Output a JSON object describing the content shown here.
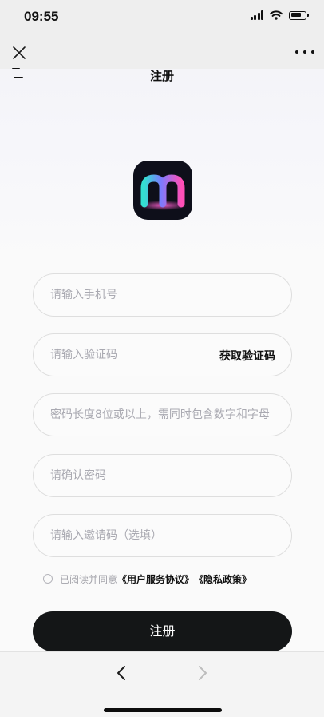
{
  "status_bar": {
    "time": "09:55",
    "icons": [
      "cellular-signal-icon",
      "wifi-icon",
      "battery-icon"
    ]
  },
  "webview_nav": {
    "close_icon": "close-icon",
    "more_icon": "more-dots-icon"
  },
  "page": {
    "title": "注册"
  },
  "form": {
    "phone_placeholder": "请输入手机号",
    "code_placeholder": "请输入验证码",
    "get_code_label": "获取验证码",
    "password_placeholder": "密码长度8位或以上，需同时包含数字和字母",
    "confirm_placeholder": "请确认密码",
    "invite_placeholder": "请输入邀请码（选填）"
  },
  "agreement": {
    "prefix": "已阅读并同意",
    "terms_link": "《用户服务协议》",
    "privacy_link": "《隐私政策》"
  },
  "submit": {
    "label": "注册"
  },
  "bottom_nav": {
    "back_icon": "chevron-left-icon",
    "forward_icon": "chevron-right-icon"
  },
  "colors": {
    "primary": "#141617",
    "placeholder": "#a9a9b1",
    "border": "#dedede",
    "background": "#fafafa"
  }
}
